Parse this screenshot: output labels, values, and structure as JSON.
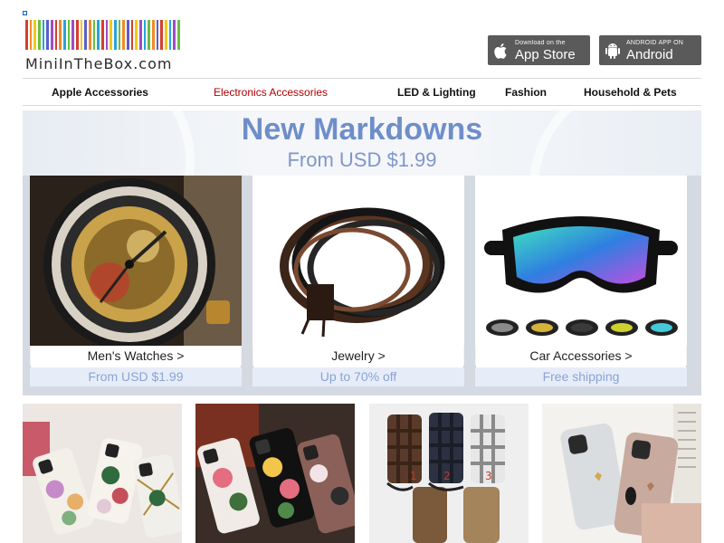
{
  "site": {
    "logo_text": "MiniInTheBox.com",
    "barcode_colors": [
      "#d33f2f",
      "#f18b2b",
      "#f0c91d",
      "#6bbf3b",
      "#2aa4d8",
      "#5b5fc7",
      "#a04cc4",
      "#d33f2f",
      "#f18b2b",
      "#2aa4d8",
      "#6bbf3b",
      "#a04cc4",
      "#d33f2f",
      "#f0c91d",
      "#5b5fc7",
      "#f18b2b",
      "#6bbf3b",
      "#2aa4d8",
      "#d33f2f",
      "#a04cc4",
      "#f0c91d",
      "#2aa4d8",
      "#6bbf3b",
      "#f18b2b",
      "#5b5fc7",
      "#d33f2f",
      "#f0c91d",
      "#a04cc4",
      "#2aa4d8",
      "#6bbf3b",
      "#f18b2b",
      "#5b5fc7",
      "#d33f2f",
      "#f0c91d",
      "#2aa4d8",
      "#a04cc4",
      "#6bbf3b"
    ]
  },
  "badges": {
    "appstore": {
      "small": "Download on the",
      "big": "App Store",
      "icon": "apple-icon"
    },
    "android": {
      "small": "ANDROID APP ON",
      "big": "Android",
      "icon": "android-icon"
    }
  },
  "nav": [
    {
      "label": "Apple Accessories",
      "active": false
    },
    {
      "label": "Electronics Accessories",
      "active": true
    },
    {
      "label": "LED & Lighting",
      "active": false
    },
    {
      "label": "Fashion",
      "active": false
    },
    {
      "label": "Household & Pets",
      "active": false
    }
  ],
  "banner": {
    "headline": "New Markdowns",
    "subline": "From USD $1.99",
    "cards": [
      {
        "label": "Men's Watches >",
        "offer": "From USD $1.99",
        "image": "watch-image"
      },
      {
        "label": "Jewelry >",
        "offer": "Up to 70% off",
        "image": "bracelet-image"
      },
      {
        "label": "Car Accessories >",
        "offer": "Free shipping",
        "image": "goggles-image"
      }
    ]
  },
  "thumbnails": [
    {
      "image": "floral-phone-cases-image"
    },
    {
      "image": "flower-print-phone-cases-image"
    },
    {
      "image": "checkered-phone-cases-image"
    },
    {
      "image": "pastel-phone-cases-image"
    }
  ],
  "colors": {
    "active_nav": "#b00000",
    "headline": "#6f8ec9",
    "offer": "#89a3d6",
    "badge_bg": "#5a5a5a"
  }
}
